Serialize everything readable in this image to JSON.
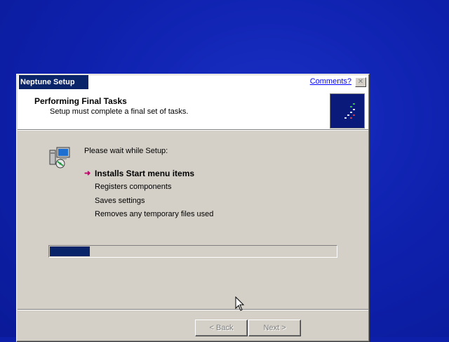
{
  "window": {
    "title": "Neptune Setup",
    "comments_link": "Comments?",
    "close_glyph": "✕"
  },
  "header": {
    "title": "Performing Final Tasks",
    "subtitle": "Setup must complete a final set of tasks."
  },
  "body": {
    "wait_label": "Please wait while Setup:",
    "current_marker": "➜",
    "tasks": [
      {
        "label": "Installs Start menu items",
        "state": "current"
      },
      {
        "label": "Registers components",
        "state": "pending"
      },
      {
        "label": "Saves settings",
        "state": "pending"
      },
      {
        "label": "Removes any temporary files used",
        "state": "pending"
      }
    ]
  },
  "progress": {
    "fraction": 0.145
  },
  "buttons": {
    "back_label": "< Back",
    "next_label": "Next >"
  },
  "colors": {
    "desktop": "#0d1fa8",
    "title_active": "#0a246a",
    "progress_fill": "#0a246a",
    "current_arrow": "#c8006e",
    "link": "#0000ff"
  },
  "icons": {
    "header_logo": "neptune-logo-icon",
    "setup": "computer-setup-icon",
    "cursor": "mouse-pointer-icon"
  }
}
